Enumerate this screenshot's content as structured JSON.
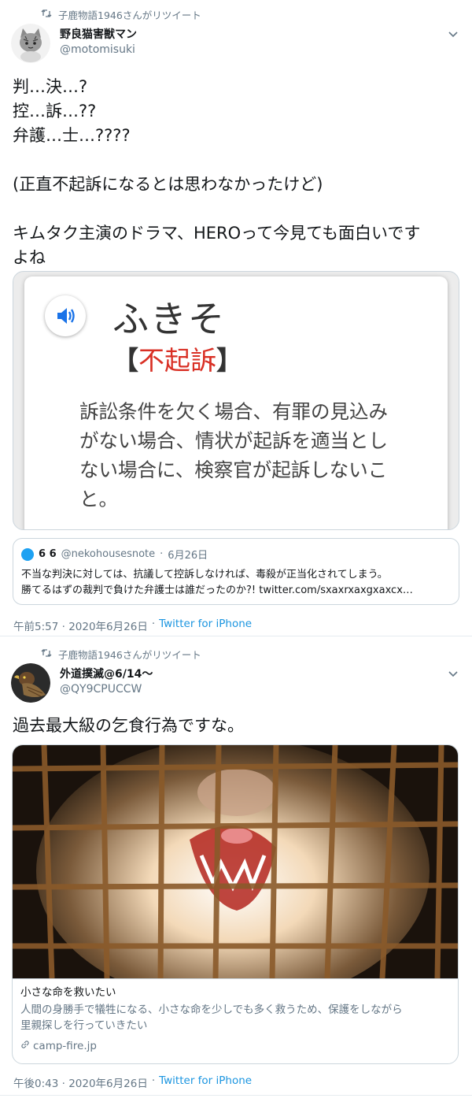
{
  "tweets": [
    {
      "retweet_label": "子鹿物語1946さんがリツイート",
      "display_name": "野良猫害獣マン",
      "handle": "@motomisuki",
      "lines": [
        "判…決…?",
        "控…訴…??",
        "弁護…士…????",
        "",
        "(正直不起訴になるとは思わなかったけど)",
        "",
        "キムタク主演のドラマ、HEROって今見ても面白いです",
        "よね"
      ],
      "dictionary_card": {
        "reading": "ふきそ",
        "term_open": "【",
        "term": "不起訴",
        "term_close": "】",
        "definition_lines": [
          "訴訟条件を欠く場合、有罪の見込み",
          "がない場合、情状が起訴を適当とし",
          "ない場合に、検察官が起訴しないこ",
          "と。"
        ]
      },
      "quote": {
        "name": "6 6",
        "handle": "@nekohousesnote",
        "date": "6月26日",
        "dot": "·",
        "lines": [
          "不当な判決に対しては、抗議して控訴しなければ、毒殺が正当化されてしまう。",
          "勝てるはずの裁判で負けた弁護士は誰だったのか?!  twitter.com/sxaxrxaxgxaxcx…"
        ]
      },
      "timestamp": "午前5:57 · 2020年6月26日",
      "dot": "·",
      "source": "Twitter for iPhone"
    },
    {
      "retweet_label": "子鹿物語1946さんがリツイート",
      "display_name": "外道撲滅@6/14〜",
      "handle": "@QY9CPUCCW",
      "lines": [
        "過去最大級の乞食行為ですな。"
      ],
      "link_card": {
        "title": "小さな命を救いたい",
        "description_lines": [
          "人間の身勝手で犠牲になる、小さな命を少しでも多く救うため、保護をしながら",
          "里親探しを行っていきたい"
        ],
        "domain": "camp-fire.jp"
      },
      "timestamp": "午後0:43 · 2020年6月26日",
      "dot": "·",
      "source": "Twitter for iPhone"
    }
  ],
  "icons": {
    "retweet": "⟲",
    "caret": "⌄",
    "speaker": "speaker-icon",
    "link": "🔗"
  },
  "colors": {
    "accent": "#1b95e0",
    "secondary_text": "#657786",
    "dictionary_term_red": "#d93025",
    "speaker_blue": "#1a73e8"
  }
}
